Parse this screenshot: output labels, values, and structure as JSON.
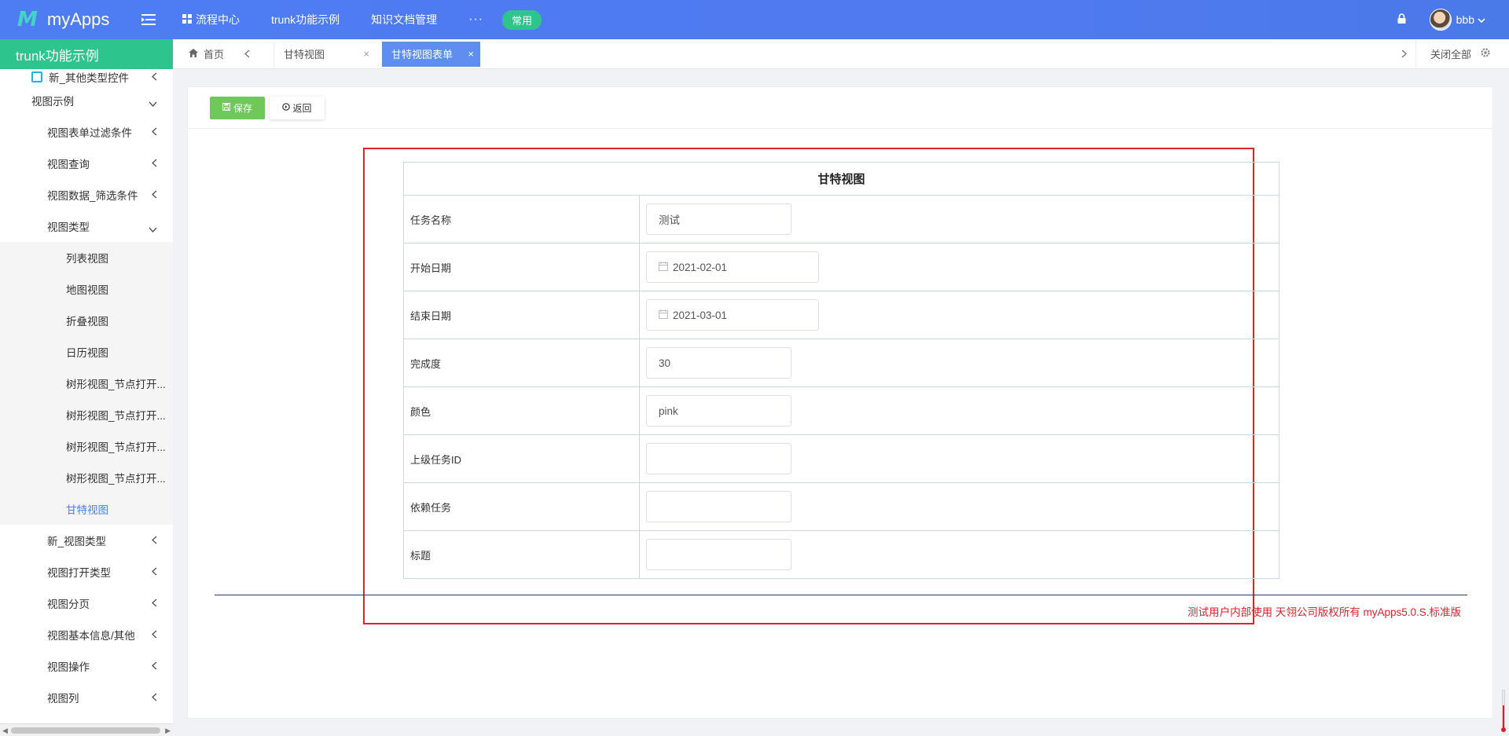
{
  "app": {
    "logo_mark": "M",
    "name": "myApps"
  },
  "topnav": {
    "items": [
      "流程中心",
      "trunk功能示例",
      "知识文档管理"
    ],
    "more": "···",
    "common": "常用"
  },
  "user": {
    "name": "bbb"
  },
  "sidebar": {
    "header": "trunk功能示例",
    "items": [
      {
        "label": "新_其他类型控件"
      },
      {
        "label": "视图示例"
      },
      {
        "label": "视图表单过滤条件"
      },
      {
        "label": "视图查询"
      },
      {
        "label": "视图数据_筛选条件"
      },
      {
        "label": "视图类型"
      },
      {
        "label": "列表视图"
      },
      {
        "label": "地图视图"
      },
      {
        "label": "折叠视图"
      },
      {
        "label": "日历视图"
      },
      {
        "label": "树形视图_节点打开..."
      },
      {
        "label": "树形视图_节点打开..."
      },
      {
        "label": "树形视图_节点打开..."
      },
      {
        "label": "树形视图_节点打开..."
      },
      {
        "label": "甘特视图"
      },
      {
        "label": "新_视图类型"
      },
      {
        "label": "视图打开类型"
      },
      {
        "label": "视图分页"
      },
      {
        "label": "视图基本信息/其他"
      },
      {
        "label": "视图操作"
      },
      {
        "label": "视图列"
      }
    ]
  },
  "tabs": {
    "home": "首页",
    "items": [
      {
        "label": "甘特视图",
        "close": "×"
      },
      {
        "label": "甘特视图表单",
        "close": "×"
      }
    ],
    "close_all": "关闭全部"
  },
  "toolbar": {
    "save": "保存",
    "back": "返回"
  },
  "form": {
    "title": "甘特视图",
    "rows": [
      {
        "label": "任务名称",
        "value": "测试"
      },
      {
        "label": "开始日期",
        "value": "2021-02-01"
      },
      {
        "label": "结束日期",
        "value": "2021-03-01"
      },
      {
        "label": "完成度",
        "value": "30"
      },
      {
        "label": "颜色",
        "value": "pink"
      },
      {
        "label": "上级任务ID",
        "value": ""
      },
      {
        "label": "依赖任务",
        "value": ""
      },
      {
        "label": "标题",
        "value": ""
      }
    ]
  },
  "footer": {
    "copyright": "测试用户内部使用 天翎公司版权所有 myApps5.0.S.标准版"
  },
  "colors": {
    "brand": "#4f7af0",
    "green": "#2dc58d",
    "active_tab": "#5d8ef0",
    "highlight": "#e0222b",
    "save": "#6fc85a"
  }
}
